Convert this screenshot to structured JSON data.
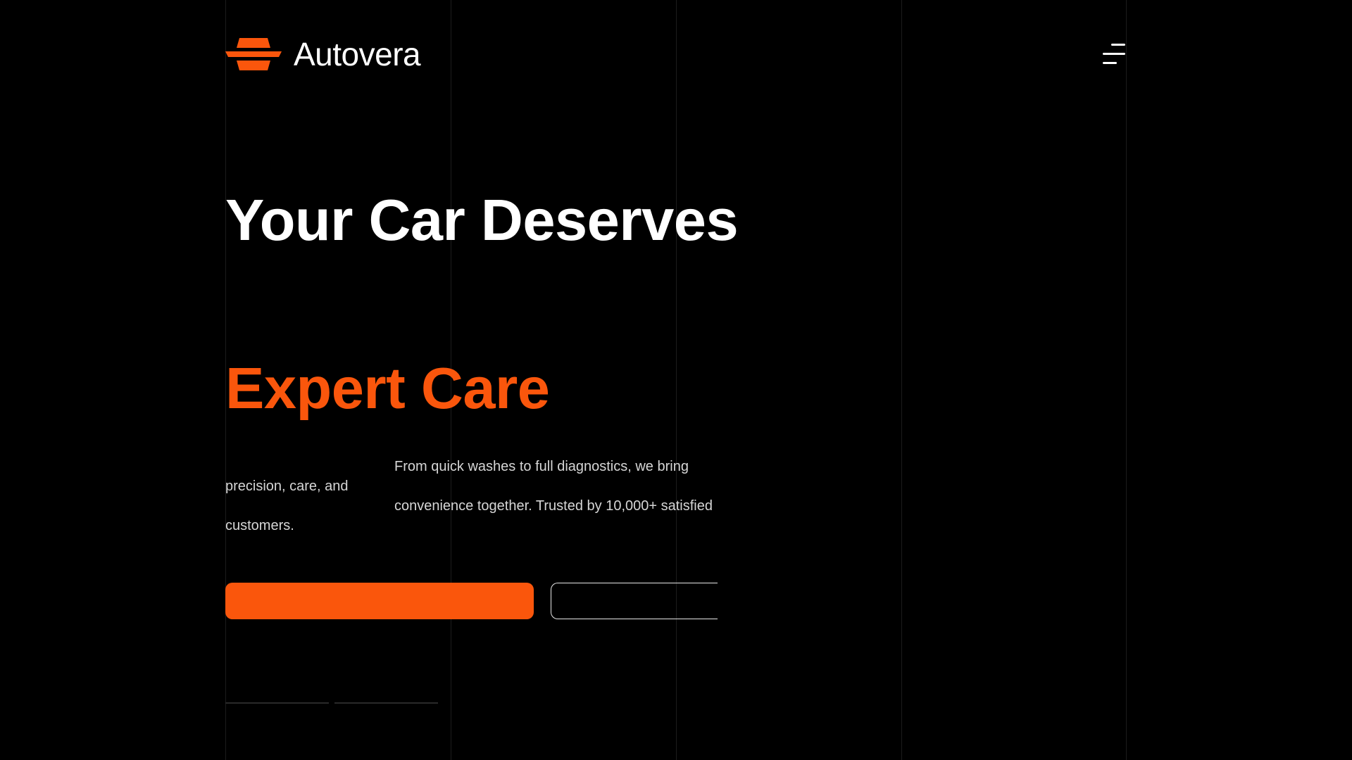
{
  "brand": {
    "name": "Autovera",
    "logo_icon": "autovera-logo-icon"
  },
  "header": {
    "menu_icon": "menu-icon"
  },
  "hero": {
    "title_line_1": "Your Car Deserves",
    "title_line_2": "Expert Care",
    "description_line_1": "From quick washes to full diagnostics, we bring",
    "description_line_2": "precision, care, and",
    "description_line_3": "convenience together. Trusted by 10,000+ satisfied",
    "description_line_4": "customers."
  },
  "colors": {
    "background": "#000000",
    "accent": "#FA560C",
    "text": "#FFFFFF",
    "muted_text": "#D6D6D6",
    "grid_line": "#1C1C1C"
  }
}
